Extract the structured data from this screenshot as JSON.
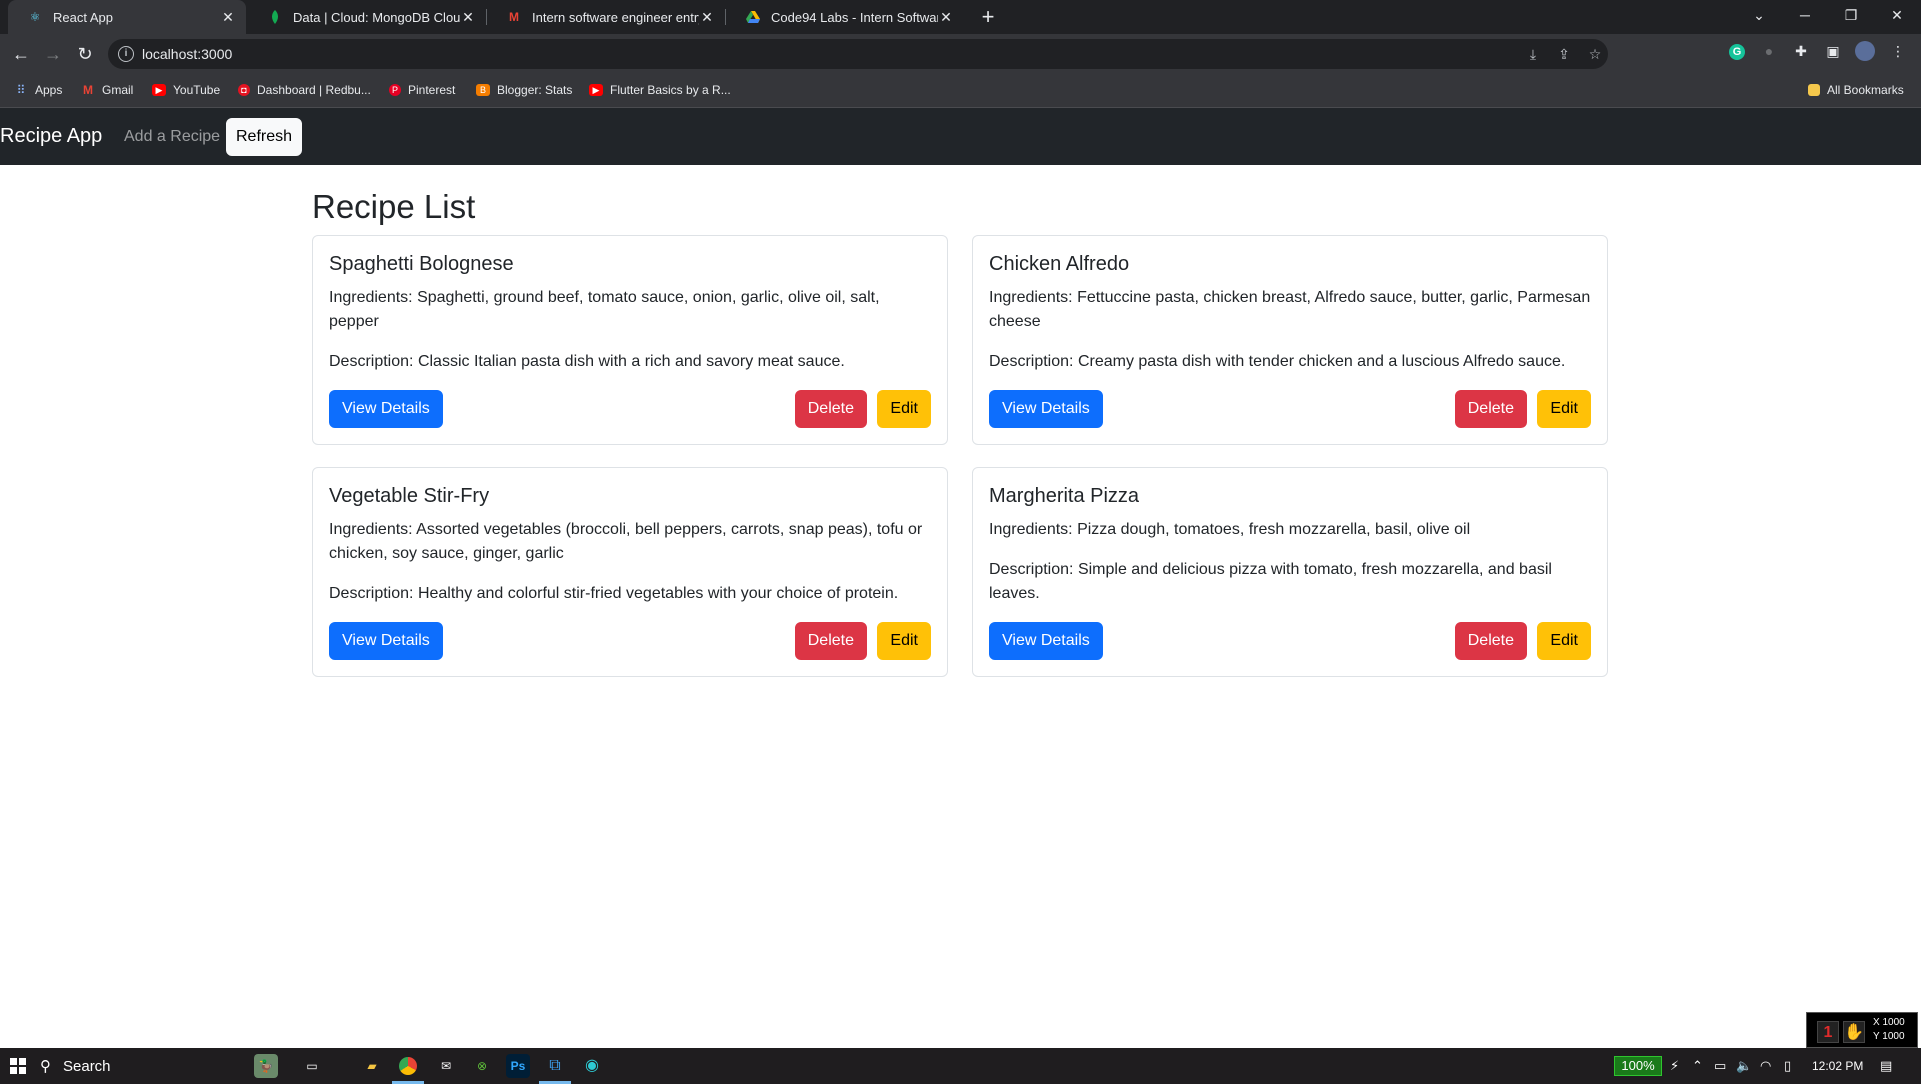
{
  "browser": {
    "tabs": [
      {
        "title": "React App",
        "icon": "react-icon",
        "active": true
      },
      {
        "title": "Data | Cloud: MongoDB Cloud",
        "icon": "mongodb-leaf-icon",
        "active": false
      },
      {
        "title": "Intern software engineer entry le",
        "icon": "gmail-icon",
        "active": false
      },
      {
        "title": "Code94 Labs - Intern Software E",
        "icon": "google-drive-icon",
        "active": false
      }
    ],
    "new_tab": "+",
    "url": "localhost:3000",
    "bookmarks": [
      {
        "label": "Apps",
        "icon": "apps-grid-icon"
      },
      {
        "label": "Gmail",
        "icon": "gmail-icon"
      },
      {
        "label": "YouTube",
        "icon": "youtube-icon"
      },
      {
        "label": "Dashboard | Redbu...",
        "icon": "redbubble-icon"
      },
      {
        "label": "Pinterest",
        "icon": "pinterest-icon"
      },
      {
        "label": "Blogger: Stats",
        "icon": "blogger-icon"
      },
      {
        "label": "Flutter Basics by a R...",
        "icon": "youtube-icon"
      }
    ],
    "all_bookmarks": "All Bookmarks"
  },
  "app": {
    "brand": "Recipe App",
    "nav_add": "Add a Recipe",
    "refresh_label": "Refresh",
    "page_title": "Recipe List",
    "ingredients_label": "Ingredients:",
    "description_label": "Description:",
    "view_label": "View Details",
    "delete_label": "Delete",
    "edit_label": "Edit",
    "recipes": [
      {
        "title": "Spaghetti Bolognese",
        "ingredients": "Spaghetti, ground beef, tomato sauce, onion, garlic, olive oil, salt, pepper",
        "description": "Classic Italian pasta dish with a rich and savory meat sauce."
      },
      {
        "title": "Chicken Alfredo",
        "ingredients": "Fettuccine pasta, chicken breast, Alfredo sauce, butter, garlic, Parmesan cheese",
        "description": "Creamy pasta dish with tender chicken and a luscious Alfredo sauce."
      },
      {
        "title": "Vegetable Stir-Fry",
        "ingredients": "Assorted vegetables (broccoli, bell peppers, carrots, snap peas), tofu or chicken, soy sauce, ginger, garlic",
        "description": "Healthy and colorful stir-fried vegetables with your choice of protein."
      },
      {
        "title": "Margherita Pizza",
        "ingredients": "Pizza dough, tomatoes, fresh mozzarella, basil, olive oil",
        "description": "Simple and delicious pizza with tomato, fresh mozzarella, and basil leaves."
      }
    ]
  },
  "overlay": {
    "x_text": "X 1000",
    "y_text": "Y 1000"
  },
  "taskbar": {
    "search_label": "Search",
    "battery": "100%",
    "time": "12:02 PM"
  },
  "colors": {
    "primary": "#0d6efd",
    "danger": "#dc3545",
    "warning": "#ffc107",
    "navbar": "#212529"
  }
}
